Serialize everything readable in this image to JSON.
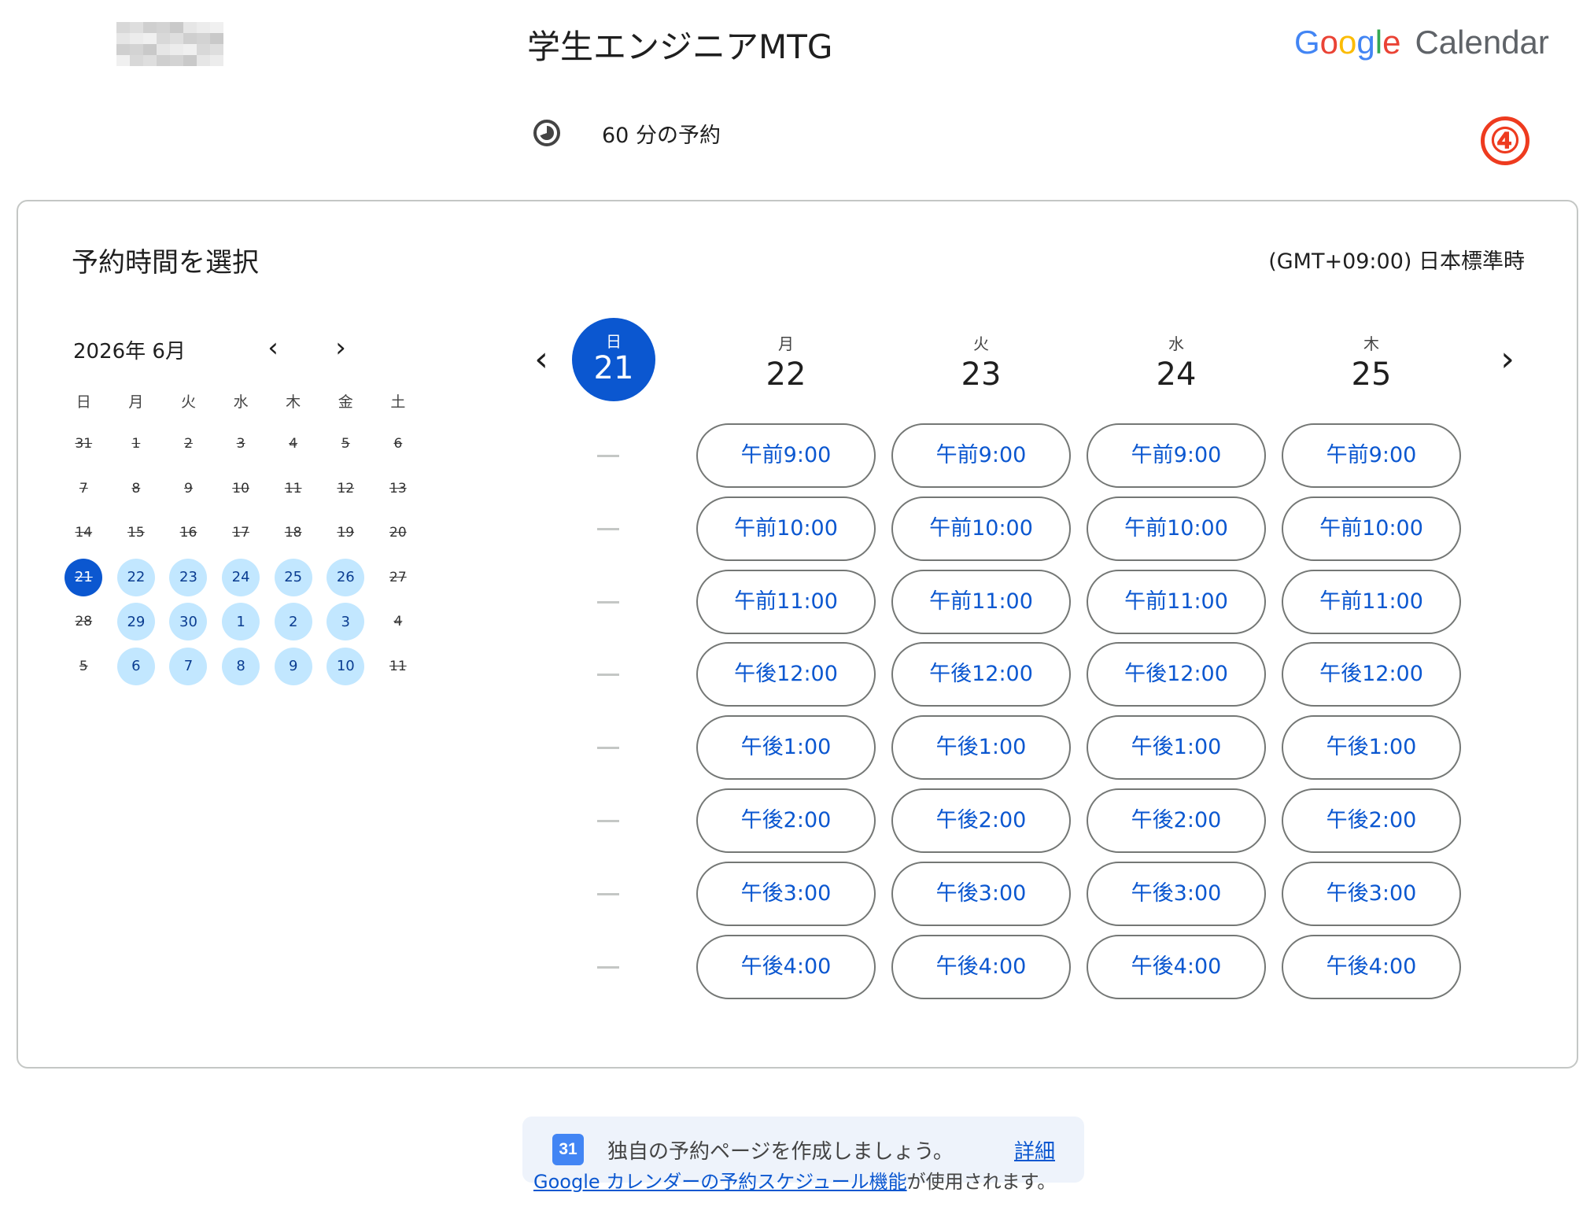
{
  "header": {
    "title": "学生エンジニアMTG",
    "logo_google": [
      "G",
      "o",
      "o",
      "g",
      "l",
      "e"
    ],
    "logo_product": "Calendar",
    "duration": "60 分の予約",
    "step_badge": "④"
  },
  "card": {
    "title": "予約時間を選択",
    "timezone": "(GMT+09:00) 日本標準時"
  },
  "mini_calendar": {
    "month_label": "2026年 6月",
    "prev_icon": "‹",
    "next_icon": "›",
    "weekdays": [
      "日",
      "月",
      "火",
      "水",
      "木",
      "金",
      "土"
    ],
    "days": [
      {
        "label": "31",
        "state": "off"
      },
      {
        "label": "1",
        "state": "off"
      },
      {
        "label": "2",
        "state": "off"
      },
      {
        "label": "3",
        "state": "off"
      },
      {
        "label": "4",
        "state": "off"
      },
      {
        "label": "5",
        "state": "off"
      },
      {
        "label": "6",
        "state": "off"
      },
      {
        "label": "7",
        "state": "off"
      },
      {
        "label": "8",
        "state": "off"
      },
      {
        "label": "9",
        "state": "off"
      },
      {
        "label": "10",
        "state": "off"
      },
      {
        "label": "11",
        "state": "off"
      },
      {
        "label": "12",
        "state": "off"
      },
      {
        "label": "13",
        "state": "off"
      },
      {
        "label": "14",
        "state": "off"
      },
      {
        "label": "15",
        "state": "off"
      },
      {
        "label": "16",
        "state": "off"
      },
      {
        "label": "17",
        "state": "off"
      },
      {
        "label": "18",
        "state": "off"
      },
      {
        "label": "19",
        "state": "off"
      },
      {
        "label": "20",
        "state": "off"
      },
      {
        "label": "21",
        "state": "sel"
      },
      {
        "label": "22",
        "state": "avail"
      },
      {
        "label": "23",
        "state": "avail"
      },
      {
        "label": "24",
        "state": "avail"
      },
      {
        "label": "25",
        "state": "avail"
      },
      {
        "label": "26",
        "state": "avail"
      },
      {
        "label": "27",
        "state": "off"
      },
      {
        "label": "28",
        "state": "off"
      },
      {
        "label": "29",
        "state": "avail"
      },
      {
        "label": "30",
        "state": "avail"
      },
      {
        "label": "1",
        "state": "avail"
      },
      {
        "label": "2",
        "state": "avail"
      },
      {
        "label": "3",
        "state": "avail"
      },
      {
        "label": "4",
        "state": "off"
      },
      {
        "label": "5",
        "state": "off"
      },
      {
        "label": "6",
        "state": "avail"
      },
      {
        "label": "7",
        "state": "avail"
      },
      {
        "label": "8",
        "state": "avail"
      },
      {
        "label": "9",
        "state": "avail"
      },
      {
        "label": "10",
        "state": "avail"
      },
      {
        "label": "11",
        "state": "off"
      }
    ]
  },
  "week": {
    "prev_icon": "‹",
    "next_icon": "›",
    "today": {
      "weekday": "日",
      "date": "21"
    },
    "dash_count": 8,
    "columns": [
      {
        "weekday": "月",
        "date": "22"
      },
      {
        "weekday": "火",
        "date": "23"
      },
      {
        "weekday": "水",
        "date": "24"
      },
      {
        "weekday": "木",
        "date": "25"
      }
    ],
    "slots": [
      "午前9:00",
      "午前10:00",
      "午前11:00",
      "午後12:00",
      "午後1:00",
      "午後2:00",
      "午後3:00",
      "午後4:00"
    ]
  },
  "promo": {
    "icon_text": "31",
    "text": "独自の予約ページを作成しましょう。",
    "link": "詳細"
  },
  "footer": {
    "link": "Google カレンダーの予約スケジュール機能",
    "suffix": "が使用されます。"
  },
  "colors": {
    "accent": "#0b57d0",
    "available_day": "#c2e7ff",
    "badge": "#ee3b1f"
  }
}
